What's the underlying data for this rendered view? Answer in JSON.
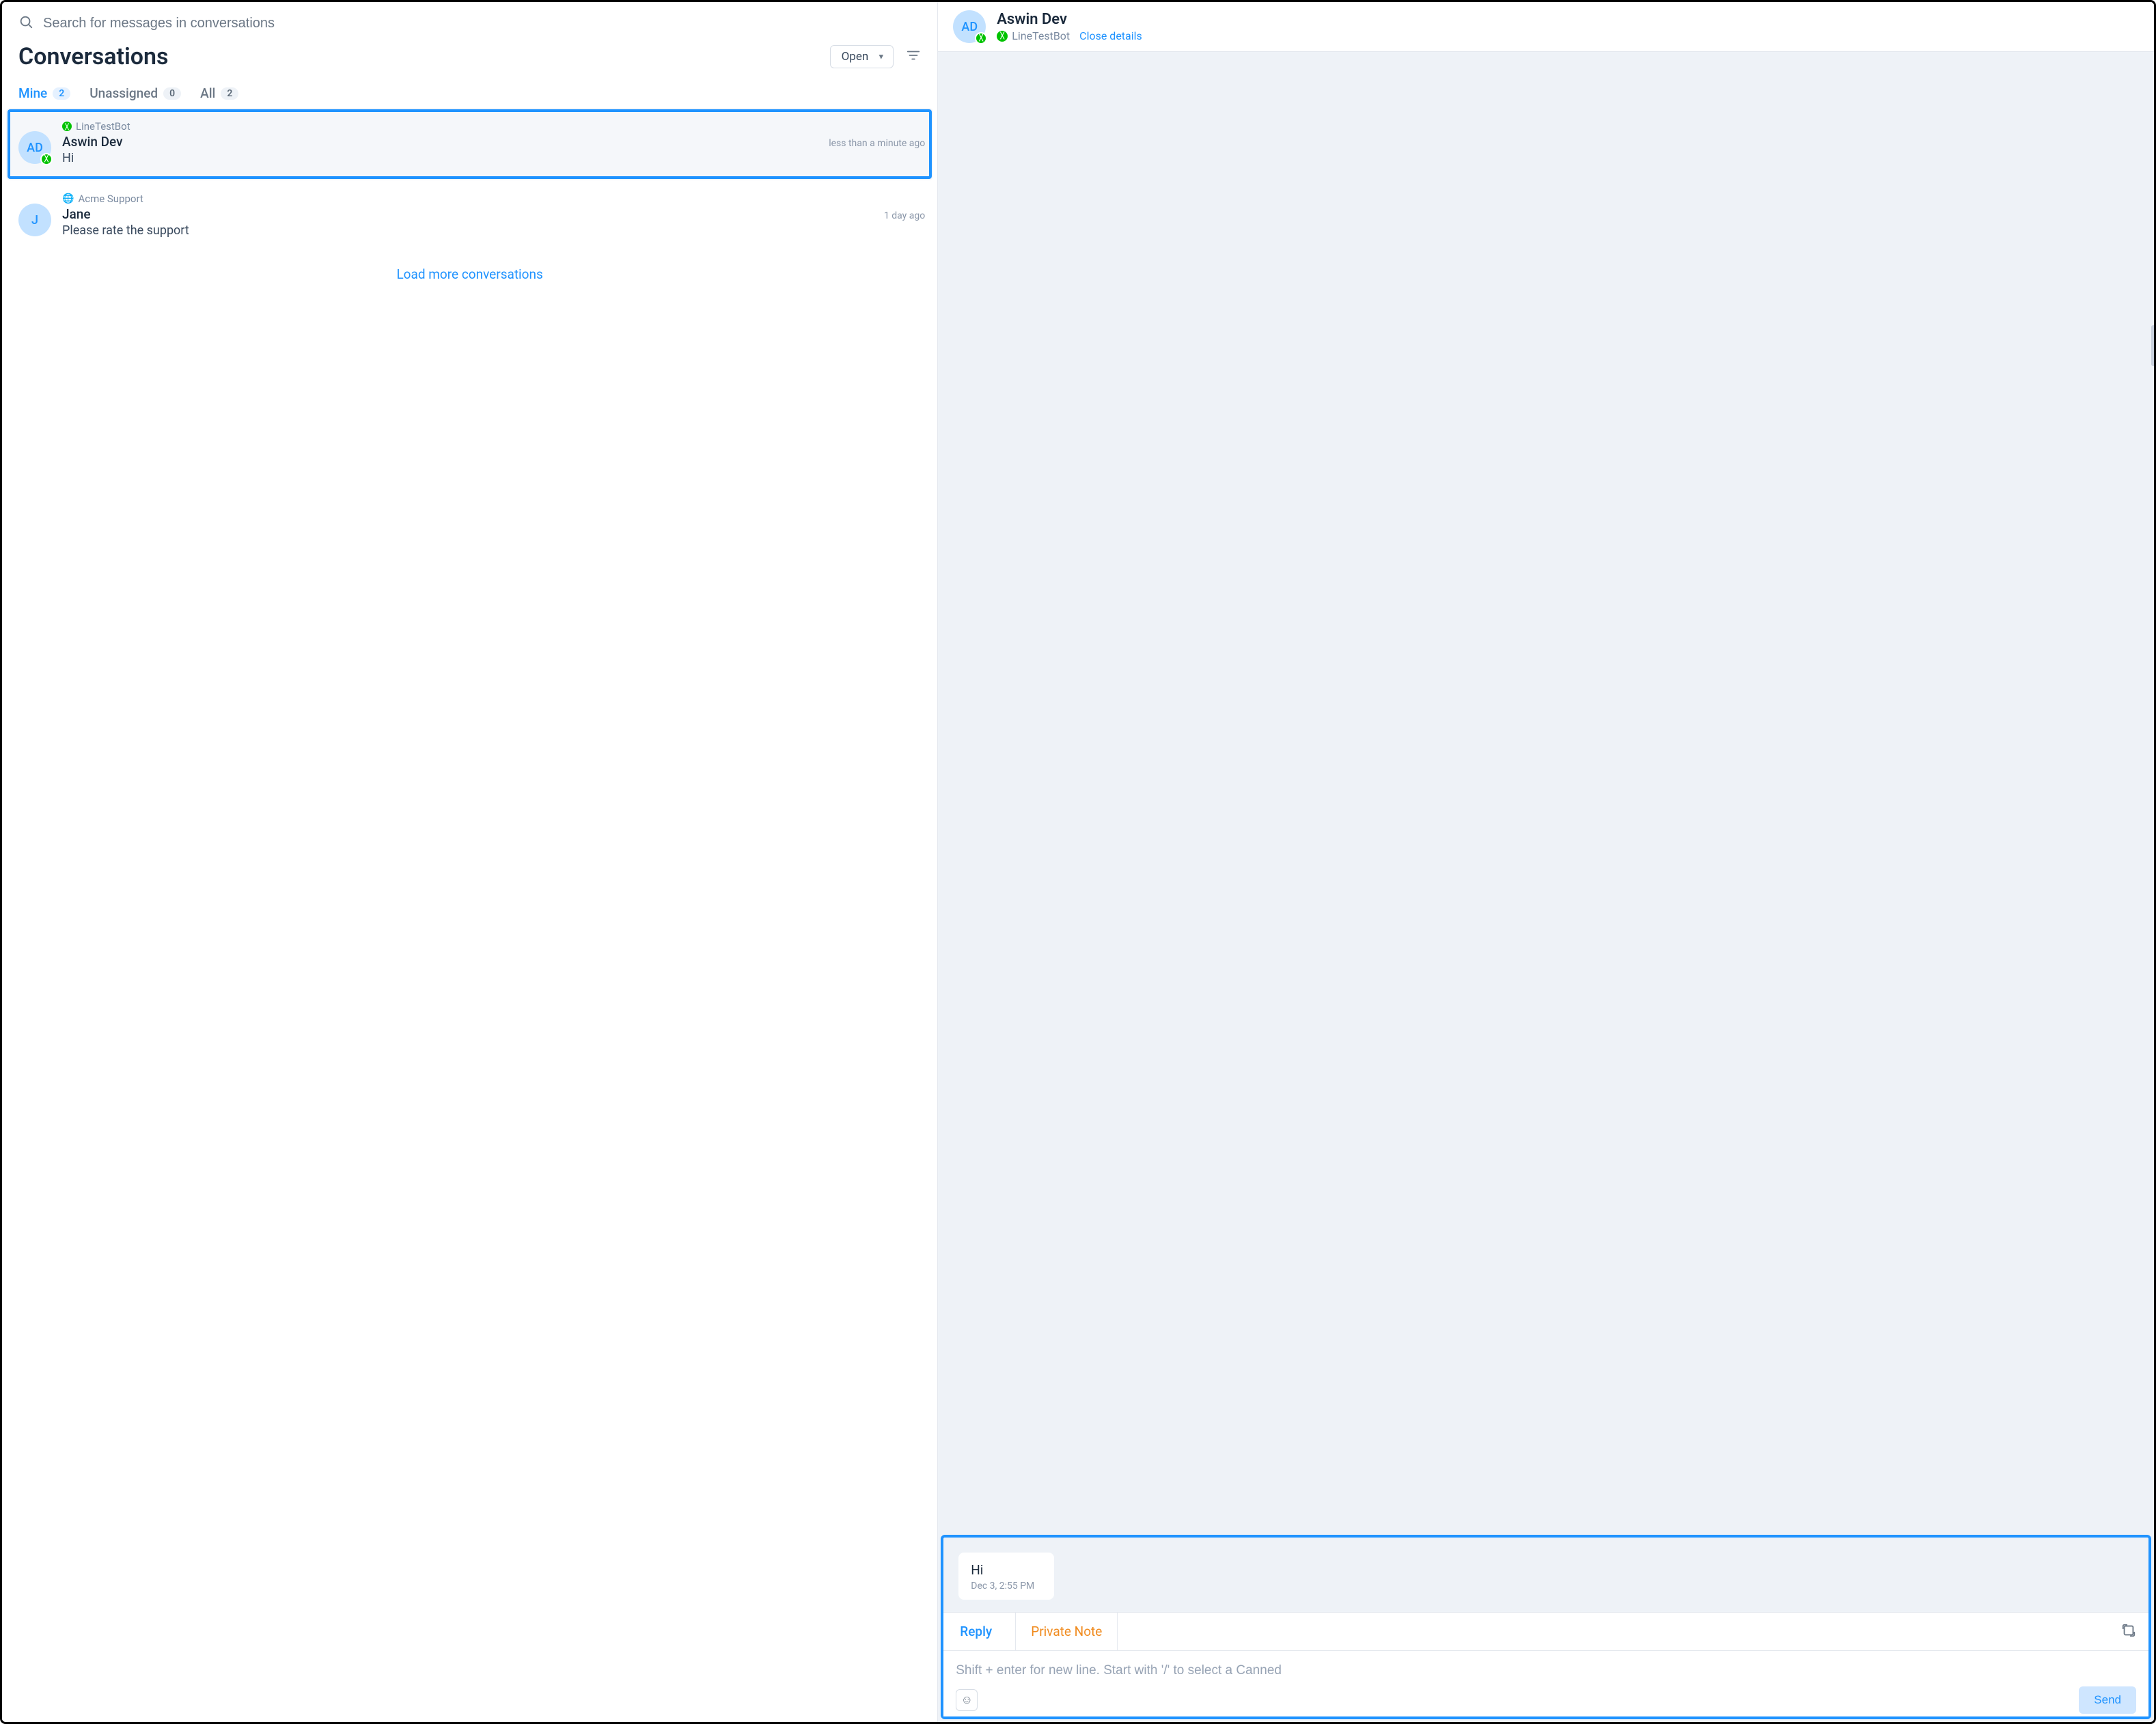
{
  "search": {
    "placeholder": "Search for messages in conversations"
  },
  "title": "Conversations",
  "status_filter": {
    "selected": "Open"
  },
  "tabs": {
    "mine": {
      "label": "Mine",
      "count": "2"
    },
    "unassigned": {
      "label": "Unassigned",
      "count": "0"
    },
    "all": {
      "label": "All",
      "count": "2"
    }
  },
  "conversations": [
    {
      "avatar": "AD",
      "channel_label": "LineTestBot",
      "channel_type": "line",
      "name": "Aswin Dev",
      "time": "less than a minute ago",
      "preview": "Hi",
      "selected": true
    },
    {
      "avatar": "J",
      "channel_label": "Acme Support",
      "channel_type": "web",
      "name": "Jane",
      "time": "1 day ago",
      "preview": "Please rate the support",
      "selected": false
    }
  ],
  "load_more": "Load more conversations",
  "detail": {
    "avatar": "AD",
    "name": "Aswin Dev",
    "channel_label": "LineTestBot",
    "close_details": "Close details",
    "message": {
      "text": "Hi",
      "timestamp": "Dec 3, 2:55 PM"
    },
    "composer_tabs": {
      "reply": "Reply",
      "private_note": "Private Note"
    },
    "composer_placeholder": "Shift + enter for new line. Start with '/' to select a Canned",
    "send_label": "Send"
  },
  "icons": {
    "search": "search-icon",
    "filter": "filter-icon",
    "globe": "globe-icon",
    "expand": "expand-icon",
    "emoji": "emoji-icon",
    "chevron-down": "chevron-down-icon",
    "line-channel": "line-channel-badge"
  }
}
